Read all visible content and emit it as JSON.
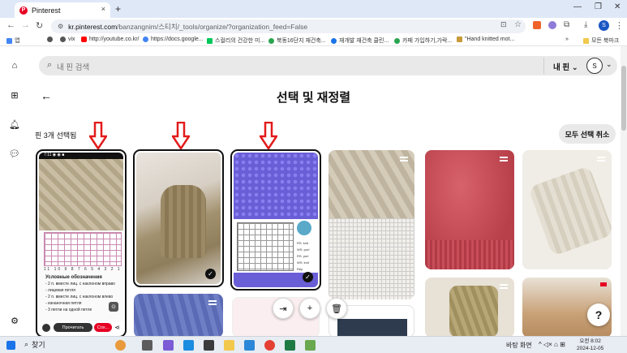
{
  "browser": {
    "tab_title": "Pinterest",
    "tab_favicon": "P",
    "tab_close": "×",
    "new_tab": "+",
    "url_host": "kr.pinterest.com",
    "url_path": "/banzangnim/스티치/_tools/organize/?organization_feed=False",
    "profile_initial": "S",
    "bookmarks": [
      {
        "label": "앱",
        "color": "#4285f4"
      },
      {
        "label": "vix",
        "color": "#555555"
      },
      {
        "label": "http://youtube.co.kr/",
        "color": "#ff0000"
      },
      {
        "label": "https://docs.google...",
        "color": "#4285f4"
      },
      {
        "label": "스컬리의 건강한 미...",
        "color": "#03c75a"
      },
      {
        "label": "북동16단지 재건축...",
        "color": "#2aa44f"
      },
      {
        "label": "재개발 재건축 클린...",
        "color": "#1a73e8"
      },
      {
        "label": "카페 가입하기,가락...",
        "color": "#2aa44f"
      },
      {
        "label": "\"Hand knitted mot...",
        "color": "#c89a3a"
      }
    ],
    "bookmarks_more": "»",
    "all_bookmarks": "모든 북마크"
  },
  "header": {
    "search_placeholder": "내 핀 검색",
    "my_pins_label": "내 핀",
    "avatar_initial": "S",
    "page_title": "선택 및 재정렬",
    "selected_count": "핀 3개 선택됨",
    "deselect_all": "모두 선택 취소"
  },
  "pins": [
    {
      "id": "pin-1",
      "selected": true,
      "desc": "knitting chart phone screenshot"
    },
    {
      "id": "pin-2",
      "selected": true,
      "color": "#a2916e"
    },
    {
      "id": "pin-3",
      "selected": true,
      "color": "#6f63d8"
    },
    {
      "id": "pin-4",
      "selected": false,
      "color": "#cbbfa9"
    },
    {
      "id": "pin-5",
      "selected": false,
      "color": "#c8505c"
    },
    {
      "id": "pin-6",
      "selected": false,
      "color": "#e8e3d6"
    }
  ],
  "phone_pin": {
    "status": "7:11 ◉ ◉ ■",
    "legend_title": "Условные обозначения",
    "legend_lines": [
      "- 2 п. вместе лиц. с наклоном вправо",
      "- лицевая петля",
      "- 2 п. вместе лиц. с наклоном влево",
      "- изнаночная петля",
      "- 3 петли на одной петле"
    ],
    "chart_numbers": "11 10 9 8 7 6 5 4 3 2 1",
    "btn_read": "Прочитать",
    "btn_more": "Сох..."
  },
  "stitch_chart_labels": [
    "RS: knit",
    "WS: purl",
    "RS: purl",
    "WS: knit",
    "Rep"
  ],
  "toolbar": {
    "move_icon": "⇥",
    "add_icon": "+",
    "delete_icon": "🗑"
  },
  "help_label": "?",
  "taskbar": {
    "search_label": "찾기",
    "tray_text": "바탕 화면",
    "time": "오전 8:02",
    "date": "2024-12-05"
  }
}
